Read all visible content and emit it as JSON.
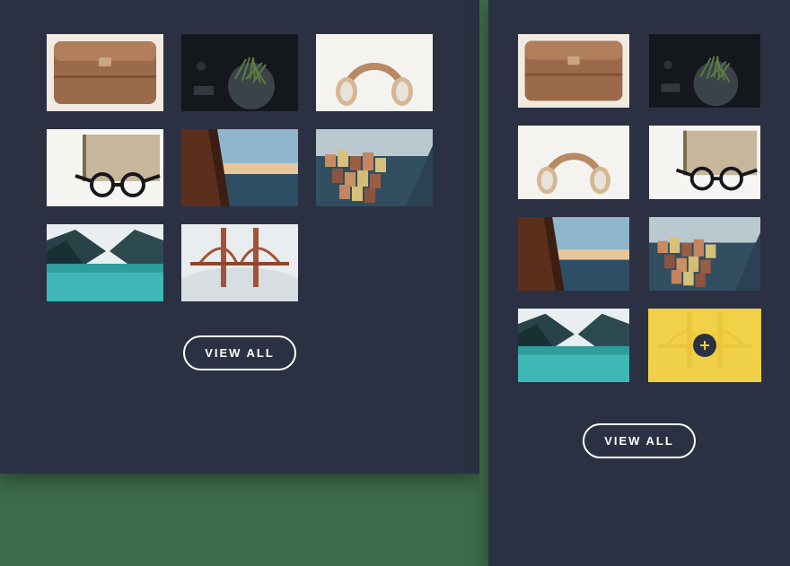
{
  "button_label": "VIEW ALL",
  "plus_label": "add",
  "left": {
    "items": [
      "bag",
      "plant",
      "headphones",
      "glasses",
      "cliff",
      "village",
      "lake",
      "bridge"
    ]
  },
  "right": {
    "items": [
      "bag",
      "plant",
      "headphones",
      "glasses",
      "cliff",
      "village",
      "lake",
      "bridge"
    ],
    "overlay_index": 7
  }
}
